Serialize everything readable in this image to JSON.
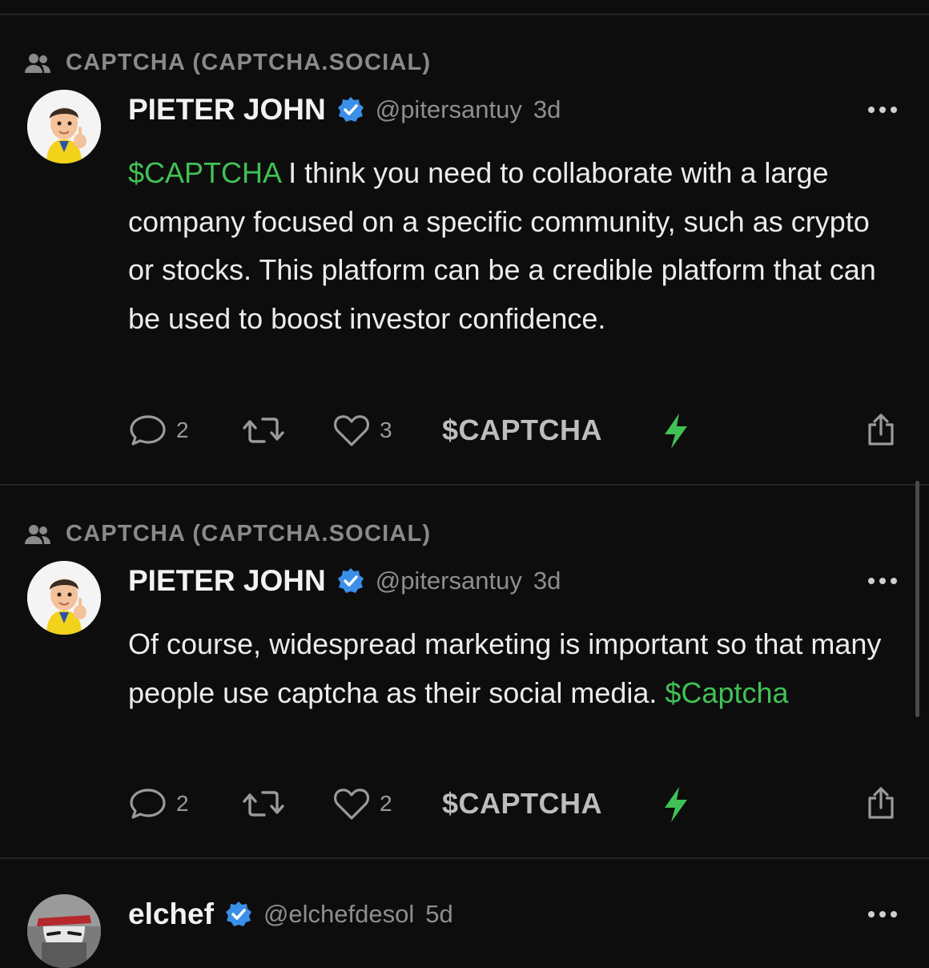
{
  "colors": {
    "background": "#0d0d0d",
    "cashtag": "#41c155",
    "verified": "#3a8fe8",
    "muted": "#8e8e8e"
  },
  "posts": [
    {
      "context": "CAPTCHA (CAPTCHA.SOCIAL)",
      "author": "PIETER JOHN",
      "handle": "@pitersantuy",
      "time": "3d",
      "body_prefix_tag": "$CAPTCHA",
      "body_text": " I think you need to collaborate with a large company focused on a specific community, such as crypto or stocks. This platform can be a credible platform that can be used to boost investor confidence.",
      "replies": "2",
      "likes": "3",
      "ticker": "$CAPTCHA"
    },
    {
      "context": "CAPTCHA (CAPTCHA.SOCIAL)",
      "author": "PIETER JOHN",
      "handle": "@pitersantuy",
      "time": "3d",
      "body_text": "Of course, widespread marketing is important so that many people use captcha as their social media. ",
      "body_suffix_tag": "$Captcha",
      "replies": "2",
      "likes": "2",
      "ticker": "$CAPTCHA"
    },
    {
      "author": "elchef",
      "handle": "@elchefdesol",
      "time": "5d"
    }
  ],
  "icons": [
    "community-icon",
    "verified-badge-icon",
    "more-icon",
    "reply-icon",
    "repost-icon",
    "like-icon",
    "bolt-icon",
    "share-icon"
  ]
}
